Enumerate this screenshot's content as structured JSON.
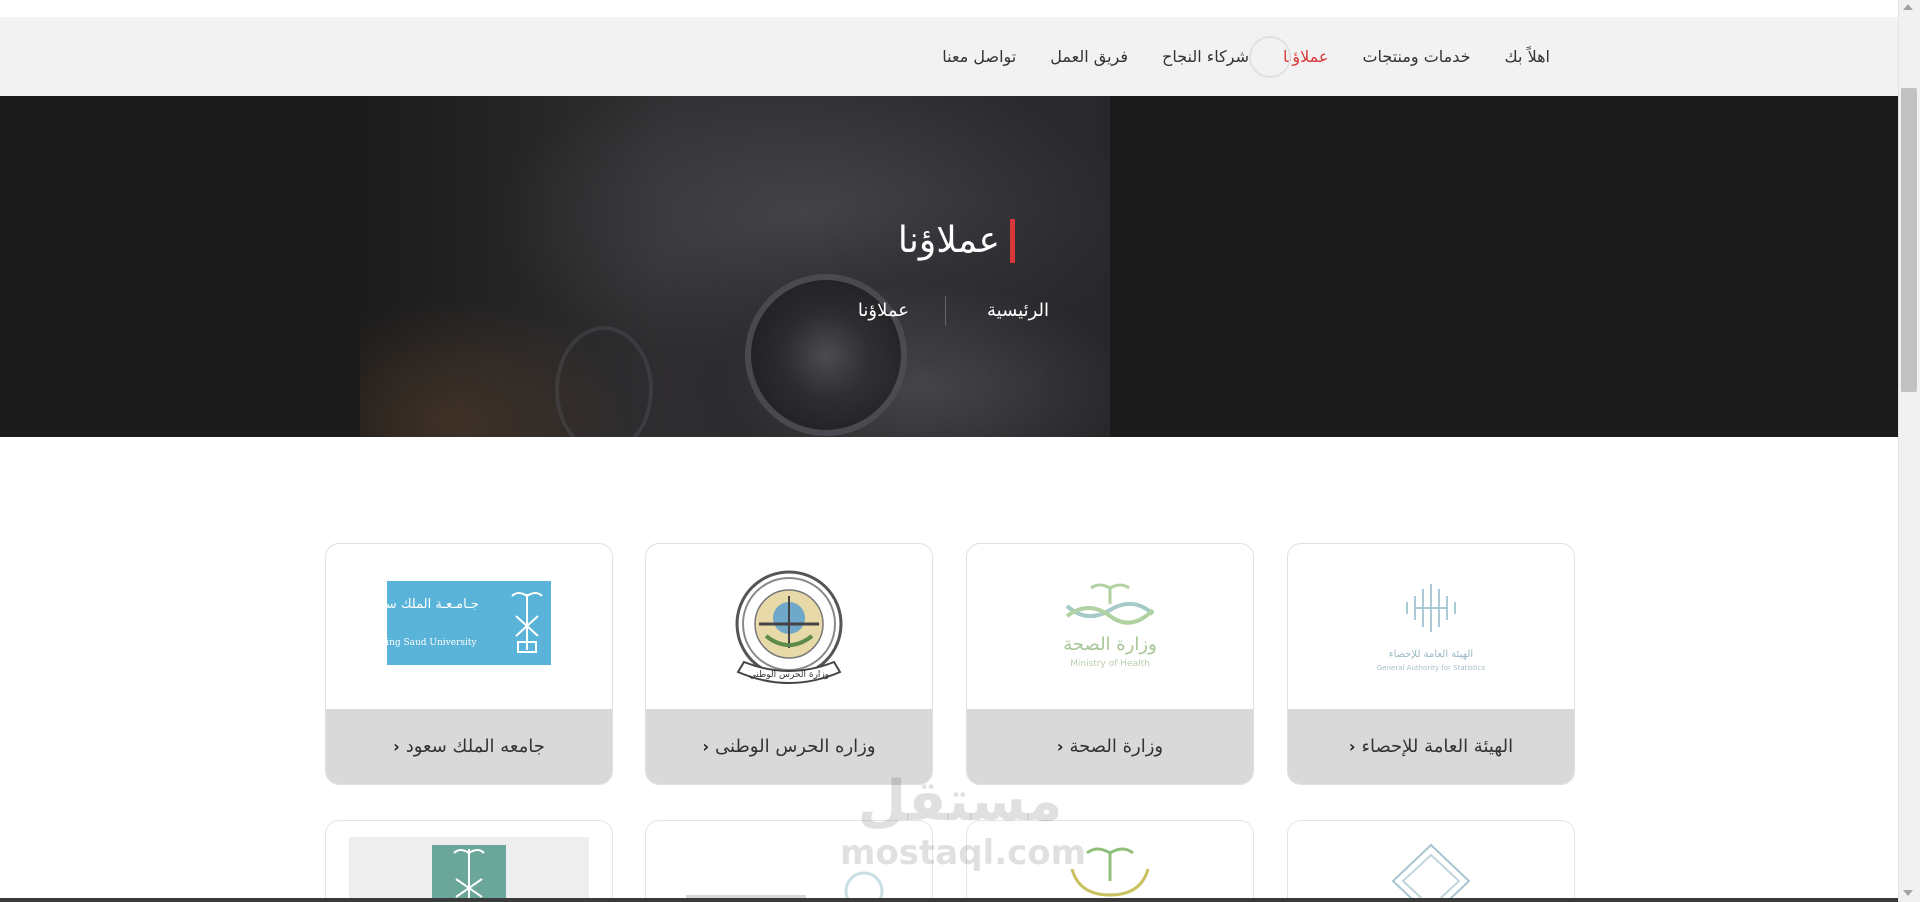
{
  "nav": {
    "items": [
      {
        "label": "اهلاً بك",
        "active": false
      },
      {
        "label": "خدمات ومنتجات",
        "active": false
      },
      {
        "label": "عملاؤنا",
        "active": true
      },
      {
        "label": "شركاء النجاح",
        "active": false
      },
      {
        "label": "فريق العمل",
        "active": false
      },
      {
        "label": "تواصل معنا",
        "active": false
      }
    ]
  },
  "hero": {
    "title": "عملاؤنا",
    "breadcrumb": {
      "home": "الرئيسية",
      "current": "عملاؤنا"
    }
  },
  "clients": {
    "row1": [
      {
        "label": "الهيئة العامة للإحصاء",
        "logo_icon": "statistics-authority-logo",
        "logo_text_ar": "الهيئة العامة للإحصاء",
        "logo_text_en": "General Authority for Statistics"
      },
      {
        "label": "وزارة الصحة",
        "logo_icon": "ministry-of-health-logo",
        "logo_text_ar": "وزارة الصحة",
        "logo_text_en": "Ministry of Health"
      },
      {
        "label": "وزاره الحرس الوطنى",
        "logo_icon": "national-guard-emblem",
        "logo_text_ar": "وزارة الحرس الوطني"
      },
      {
        "label": "جامعه الملك سعود",
        "logo_icon": "king-saud-university-logo",
        "logo_text_ar": "جـامـعـة الملك سعود",
        "logo_text_en": "King Saud University"
      }
    ],
    "row2_icons": [
      "partial-logo-1",
      "partial-logo-2",
      "partial-logo-3",
      "partial-logo-4"
    ]
  },
  "watermark": {
    "ar": "مستقل",
    "en": "mostaql.com"
  },
  "colors": {
    "accent": "#d9383a",
    "nav_bg": "#f2f2f2",
    "hero_bg": "#1b1b1b",
    "card_footer_bg": "#d9d9d9",
    "ksu_blue": "#5ab4d9"
  }
}
